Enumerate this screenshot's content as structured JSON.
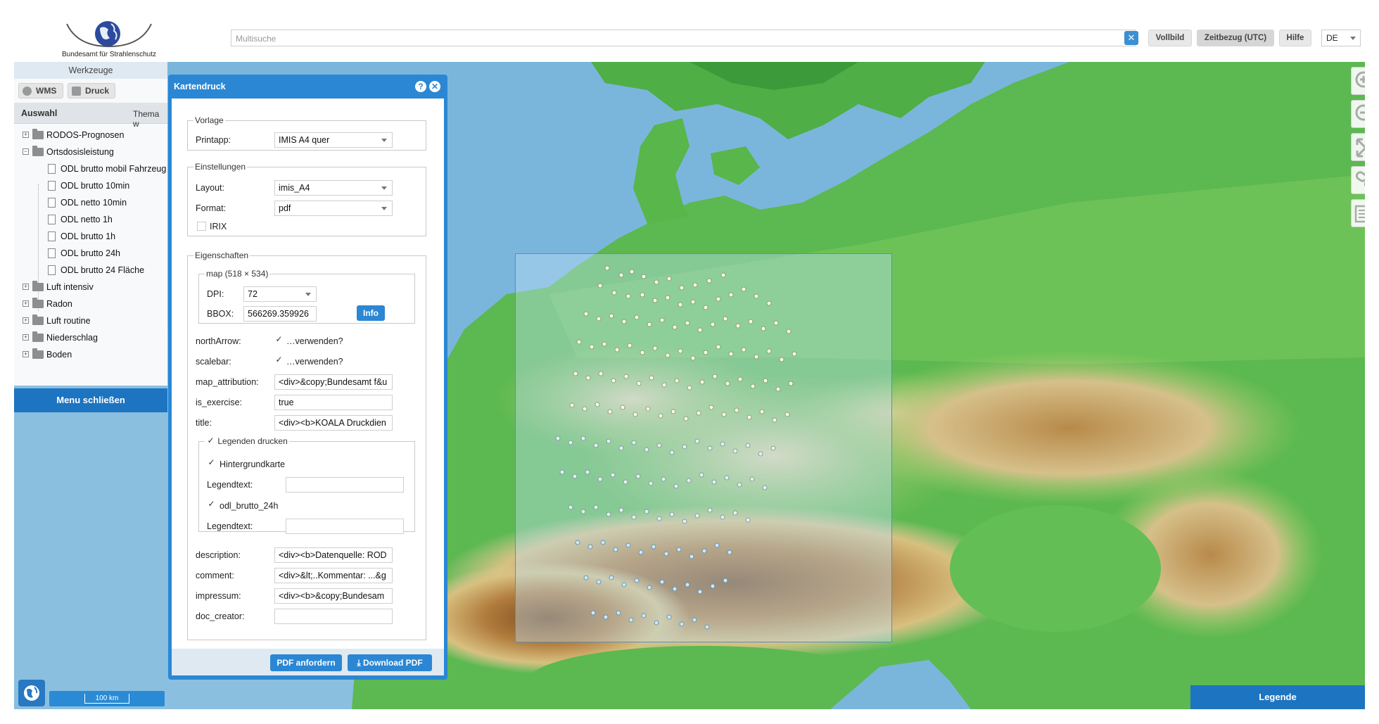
{
  "header": {
    "org_name": "Bundesamt für Strahlenschutz",
    "search_placeholder": "Multisuche",
    "buttons": {
      "fullscreen": "Vollbild",
      "time_ref": "Zeitbezug (UTC)",
      "help": "Hilfe"
    },
    "language": "DE"
  },
  "left_panel": {
    "title": "Werkzeuge",
    "buttons": {
      "wms": "WMS",
      "print": "Druck"
    },
    "tree_columns": {
      "selection": "Auswahl",
      "theme": "Thema w"
    },
    "tree": [
      {
        "label": "RODOS-Prognosen",
        "type": "folder",
        "expanded": false
      },
      {
        "label": "Ortsdosisleistung",
        "type": "folder",
        "expanded": true
      },
      {
        "label": "ODL brutto mobil Fahrzeug",
        "type": "layer"
      },
      {
        "label": "ODL brutto 10min",
        "type": "layer"
      },
      {
        "label": "ODL netto 10min",
        "type": "layer"
      },
      {
        "label": "ODL netto 1h",
        "type": "layer"
      },
      {
        "label": "ODL brutto 1h",
        "type": "layer"
      },
      {
        "label": "ODL brutto 24h",
        "type": "layer"
      },
      {
        "label": "ODL brutto 24 Fläche",
        "type": "layer"
      },
      {
        "label": "Luft intensiv",
        "type": "folder",
        "expanded": false
      },
      {
        "label": "Radon",
        "type": "folder",
        "expanded": false
      },
      {
        "label": "Luft routine",
        "type": "folder",
        "expanded": false
      },
      {
        "label": "Niederschlag",
        "type": "folder",
        "expanded": false
      },
      {
        "label": "Boden",
        "type": "folder",
        "expanded": false
      }
    ],
    "menu_close": "Menu schließen"
  },
  "dialog": {
    "title": "Kartendruck",
    "vorlage": {
      "legend": "Vorlage",
      "printapp_label": "Printapp:",
      "printapp_value": "IMIS A4 quer"
    },
    "einstellungen": {
      "legend": "Einstellungen",
      "layout_label": "Layout:",
      "layout_value": "imis_A4",
      "format_label": "Format:",
      "format_value": "pdf",
      "irix_label": "IRIX",
      "irix_checked": false
    },
    "eigenschaften": {
      "legend": "Eigenschaften",
      "map_legend": "map (518 × 534)",
      "dpi_label": "DPI:",
      "dpi_value": "72",
      "bbox_label": "BBOX:",
      "bbox_value": "566269.359926",
      "info_button": "Info",
      "north_arrow_label": "northArrow:",
      "north_arrow_text": "…verwenden?",
      "north_arrow_checked": true,
      "scalebar_label": "scalebar:",
      "scalebar_text": "…verwenden?",
      "scalebar_checked": true,
      "map_attribution_label": "map_attribution:",
      "map_attribution_value": "<div>&copy;Bundesamt f&u",
      "is_exercise_label": "is_exercise:",
      "is_exercise_value": "true",
      "title_label": "title:",
      "title_value": "<div><b>KOALA Druckdien",
      "legends": {
        "legend": "Legenden drucken",
        "checked": true,
        "items": [
          {
            "name": "Hintergrundkarte",
            "checked": true,
            "text_label": "Legendtext:",
            "text_value": ""
          },
          {
            "name": "odl_brutto_24h",
            "checked": true,
            "text_label": "Legendtext:",
            "text_value": ""
          }
        ]
      },
      "description_label": "description:",
      "description_value": "<div><b>Datenquelle: ROD",
      "comment_label": "comment:",
      "comment_value": "<div>&lt;..Kommentar: ...&g",
      "impressum_label": "impressum:",
      "impressum_value": "<div><b>&copy;Bundesam",
      "doc_creator_label": "doc_creator:",
      "doc_creator_value": ""
    },
    "footer": {
      "request_pdf": "PDF anfordern",
      "download_pdf": "Download PDF"
    }
  },
  "map": {
    "scale_label": "100 km",
    "legend_button": "Legende",
    "controls": [
      "zoom-in-icon",
      "zoom-out-icon",
      "fullscreen-icon",
      "link-icon",
      "layer-list-icon"
    ],
    "colors": {
      "accent": "#1d74c0",
      "sea": "#7ab6dc",
      "lowland": "#55b84e",
      "upland": "#d8c998",
      "mountain": "#8a5a2a"
    }
  }
}
